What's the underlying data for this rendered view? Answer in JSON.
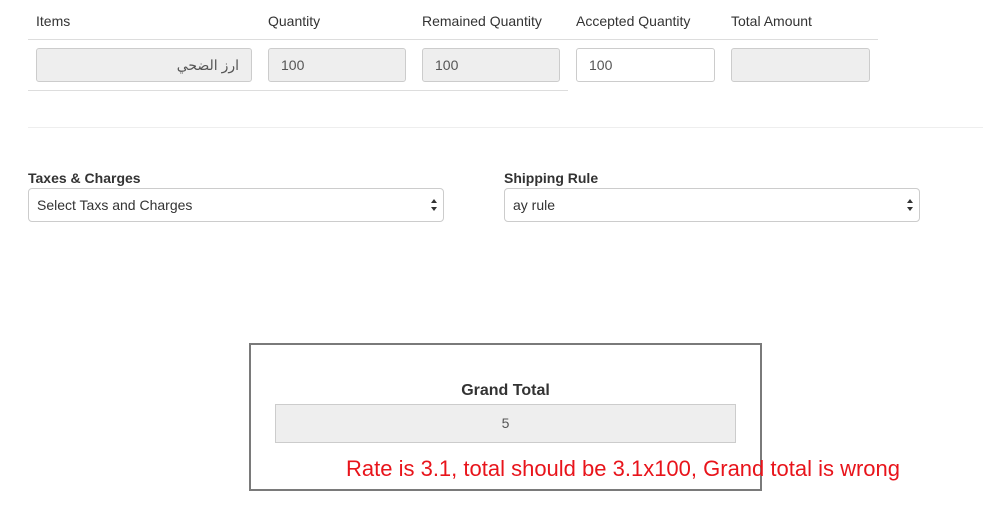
{
  "table": {
    "headers": {
      "items": "Items",
      "quantity": "Quantity",
      "remained_quantity": "Remained Quantity",
      "accepted_quantity": "Accepted Quantity",
      "total_amount": "Total Amount"
    },
    "row": {
      "item": "ارز الضحي",
      "quantity": "100",
      "remained_quantity": "100",
      "accepted_quantity": "100",
      "total_amount": ""
    }
  },
  "taxes": {
    "label": "Taxes & Charges",
    "selected": "Select Taxs and Charges"
  },
  "shipping": {
    "label": "Shipping Rule",
    "selected": "ay rule"
  },
  "grand_total": {
    "label": "Grand Total",
    "value": "5"
  },
  "annotation": {
    "text": "Rate is 3.1, total should be 3.1x100, Grand total is wrong",
    "color": "#e8141b"
  },
  "colors": {
    "readonly_bg": "#eeeeee",
    "border": "#cccccc",
    "box_border": "#7a7a7a"
  }
}
